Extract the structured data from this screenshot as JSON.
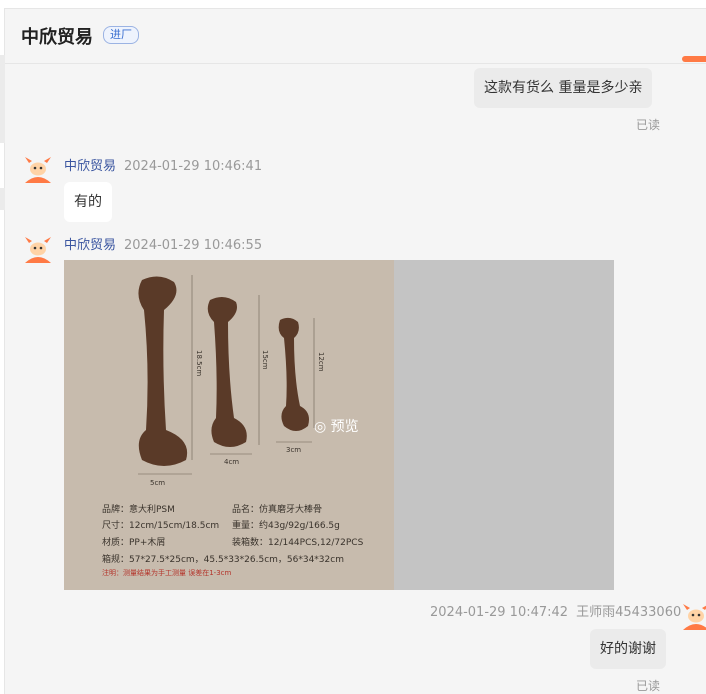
{
  "header": {
    "title": "中欣贸易",
    "badge": "进厂"
  },
  "messages": {
    "m1": {
      "text": "这款有货么  重量是多少亲",
      "status": "已读"
    },
    "m2": {
      "sender": "中欣贸易",
      "time": "2024-01-29 10:46:41",
      "text": "有的"
    },
    "m3": {
      "sender": "中欣贸易",
      "time": "2024-01-29 10:46:55",
      "preview_label": "预览",
      "product": {
        "dims": [
          "18.5cm",
          "15cm",
          "12cm",
          "5cm",
          "4cm",
          "3cm"
        ],
        "specs": [
          "品牌：意大利PSM",
          "品名：仿真磨牙大棒骨",
          "尺寸：12cm/15cm/18.5cm",
          "重量：约43g/92g/166.5g",
          "材质：PP+木屑",
          "装箱数：12/144PCS,12/72PCS",
          "箱规：57*27.5*25cm，45.5*33*26.5cm，56*34*32cm"
        ],
        "note": "注明：测量结果为手工测量 误差在1-3cm"
      }
    },
    "m4": {
      "time": "2024-01-29 10:47:42",
      "sender": "王师雨45433060",
      "text": "好的谢谢",
      "status": "已读"
    }
  },
  "colors": {
    "accent": "#ff7a45",
    "bubble": "#ebebeb",
    "sender": "#3a55a0",
    "wood": "#5a3a28"
  }
}
